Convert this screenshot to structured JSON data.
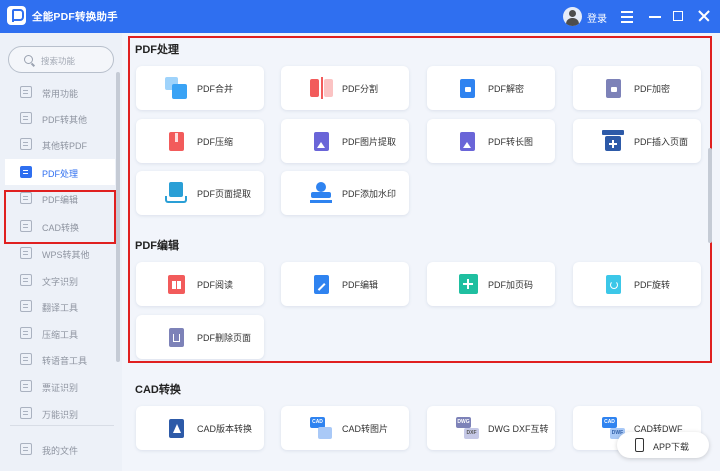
{
  "app": {
    "title": "全能PDF转换助手",
    "login": "登录"
  },
  "sidebar": {
    "search_placeholder": "搜索功能",
    "items": [
      {
        "label": "常用功能",
        "active": false
      },
      {
        "label": "PDF转其他",
        "active": false
      },
      {
        "label": "其他转PDF",
        "active": false
      },
      {
        "label": "PDF处理",
        "active": true
      },
      {
        "label": "PDF编辑",
        "active": false
      },
      {
        "label": "CAD转换",
        "active": false
      },
      {
        "label": "WPS转其他",
        "active": false
      },
      {
        "label": "文字识别",
        "active": false
      },
      {
        "label": "翻译工具",
        "active": false
      },
      {
        "label": "压缩工具",
        "active": false
      },
      {
        "label": "转语音工具",
        "active": false
      },
      {
        "label": "票证识别",
        "active": false
      },
      {
        "label": "万能识别",
        "active": false
      }
    ],
    "bottom_item": "我的文件"
  },
  "sections": [
    {
      "title": "PDF处理",
      "cards": [
        {
          "label": "PDF合并",
          "icon": "merge-icon",
          "color": "#3aa3f5"
        },
        {
          "label": "PDF分割",
          "icon": "split-icon",
          "color": "#f25b5b"
        },
        {
          "label": "PDF解密",
          "icon": "unlock-icon",
          "color": "#2f83f0"
        },
        {
          "label": "PDF加密",
          "icon": "lock-icon",
          "color": "#7d82b8"
        },
        {
          "label": "PDF压缩",
          "icon": "compress-icon",
          "color": "#f25b5b"
        },
        {
          "label": "PDF图片提取",
          "icon": "image-extract-icon",
          "color": "#6a65d8"
        },
        {
          "label": "PDF转长图",
          "icon": "long-image-icon",
          "color": "#6a65d8"
        },
        {
          "label": "PDF插入页面",
          "icon": "insert-page-icon",
          "color": "#2d5aa8"
        },
        {
          "label": "PDF页面提取",
          "icon": "page-extract-icon",
          "color": "#2a9fd6"
        },
        {
          "label": "PDF添加水印",
          "icon": "watermark-icon",
          "color": "#2f83f0"
        }
      ]
    },
    {
      "title": "PDF编辑",
      "cards": [
        {
          "label": "PDF阅读",
          "icon": "read-icon",
          "color": "#f25b5b"
        },
        {
          "label": "PDF编辑",
          "icon": "edit-icon",
          "color": "#2f83f0"
        },
        {
          "label": "PDF加页码",
          "icon": "page-number-icon",
          "color": "#1fbfa0"
        },
        {
          "label": "PDF旋转",
          "icon": "rotate-icon",
          "color": "#3cc7e8"
        },
        {
          "label": "PDF删除页面",
          "icon": "delete-page-icon",
          "color": "#7d82b8"
        }
      ]
    },
    {
      "title": "CAD转换",
      "cards": [
        {
          "label": "CAD版本转换",
          "icon": "cad-version-icon",
          "color": "#2d5aa8"
        },
        {
          "label": "CAD转图片",
          "icon": "cad-image-icon",
          "color": "#2f83f0"
        },
        {
          "label": "DWG DXF互转",
          "icon": "dwg-dxf-icon",
          "color": "#7d82b8"
        },
        {
          "label": "CAD转DWF",
          "icon": "cad-dwf-icon",
          "color": "#2f83f0"
        }
      ]
    }
  ],
  "icon_text": {
    "cad": "CAD",
    "dwg": "DWG",
    "dxf": "DXF",
    "dwf": "DWF"
  },
  "app_download": "APP下载",
  "colors": {
    "titlebar": "#2f6ff0",
    "accent": "#2f6ff0",
    "highlight": "#e02020"
  }
}
